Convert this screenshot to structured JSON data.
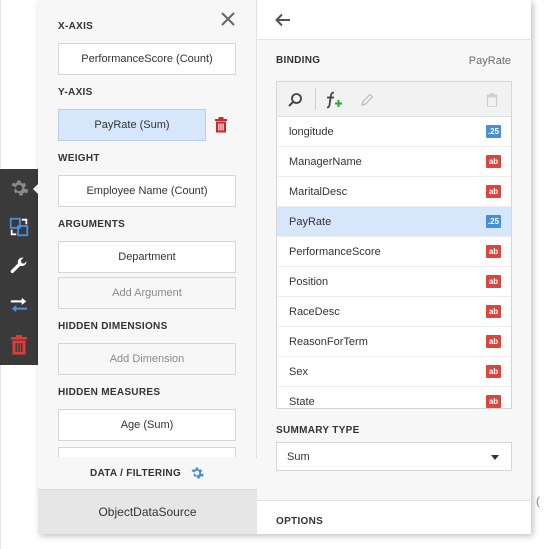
{
  "background": {
    "paren_fragment": "("
  },
  "toolbar": {
    "items": [
      {
        "icon": "gear-icon",
        "active": true
      },
      {
        "icon": "convert-icon"
      },
      {
        "icon": "wrench-icon"
      },
      {
        "icon": "swap-arrows-icon"
      },
      {
        "icon": "trash-icon"
      }
    ]
  },
  "left": {
    "x_axis": {
      "label": "X-AXIS",
      "field": "PerformanceScore (Count)"
    },
    "y_axis": {
      "label": "Y-AXIS",
      "field": "PayRate (Sum)"
    },
    "weight": {
      "label": "WEIGHT",
      "field": "Employee Name (Count)"
    },
    "arguments": {
      "label": "ARGUMENTS",
      "field": "Department",
      "add": "Add Argument"
    },
    "hidden_dimensions": {
      "label": "HIDDEN DIMENSIONS",
      "add": "Add Dimension"
    },
    "hidden_measures": {
      "label": "HIDDEN MEASURES",
      "field": "Age (Sum)"
    },
    "filtering_label": "DATA / FILTERING",
    "datasource": "ObjectDataSource"
  },
  "right": {
    "binding_label": "BINDING",
    "binding_value": "PayRate",
    "fields": [
      {
        "name": "longitude",
        "type": ".25"
      },
      {
        "name": "ManagerName",
        "type": "ab"
      },
      {
        "name": "MaritalDesc",
        "type": "ab"
      },
      {
        "name": "PayRate",
        "type": ".25",
        "selected": true
      },
      {
        "name": "PerformanceScore",
        "type": "ab"
      },
      {
        "name": "Position",
        "type": "ab"
      },
      {
        "name": "RaceDesc",
        "type": "ab"
      },
      {
        "name": "ReasonForTerm",
        "type": "ab"
      },
      {
        "name": "Sex",
        "type": "ab"
      },
      {
        "name": "State",
        "type": "ab"
      }
    ],
    "summary_type_label": "SUMMARY TYPE",
    "summary_type_value": "Sum",
    "options_label": "OPTIONS"
  },
  "colors": {
    "accent_blue": "#4a8fd6",
    "string_badge": "#d9453f",
    "selected_bg": "#d7e7fb",
    "toolbar_bg": "#3a3a3a",
    "delete_red": "#e03b3b"
  }
}
